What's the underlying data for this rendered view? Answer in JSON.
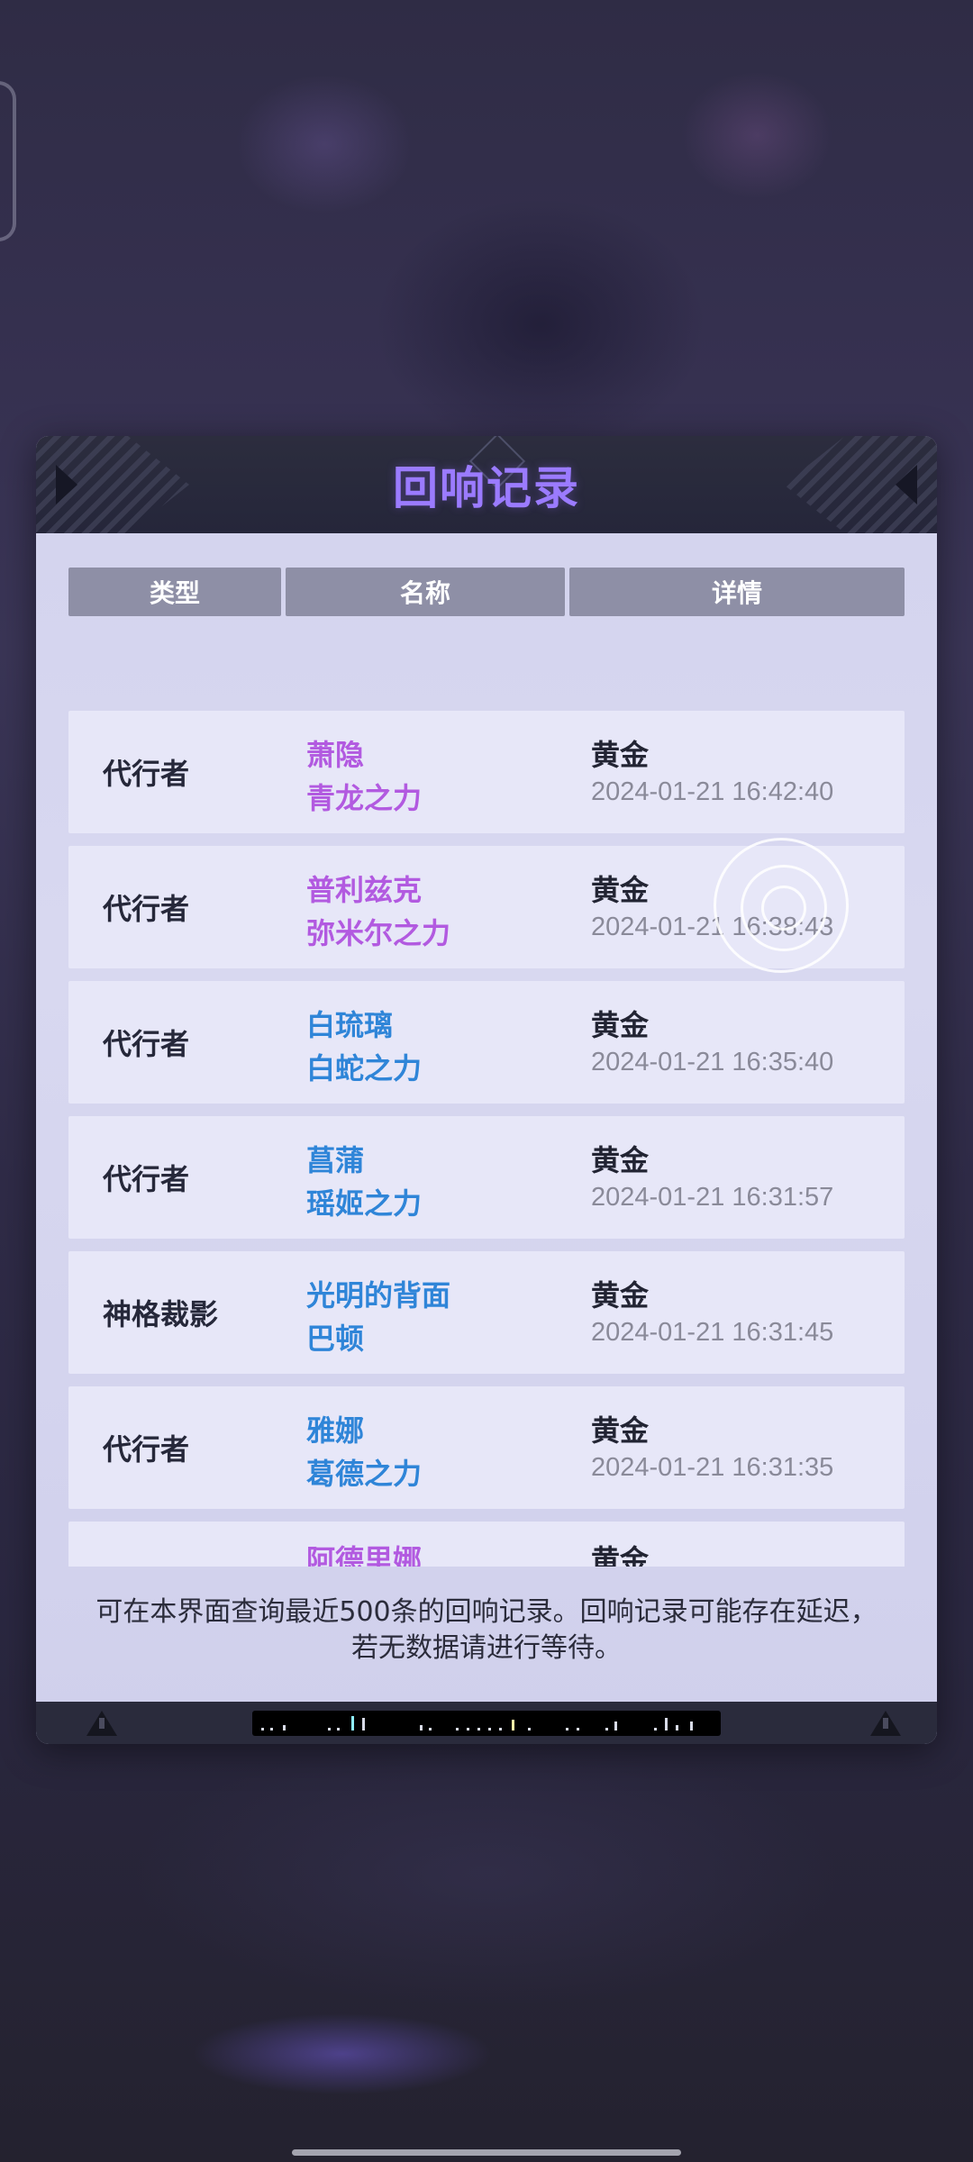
{
  "dialog": {
    "title": "回响记录",
    "columns": [
      "类型",
      "名称",
      "详情"
    ],
    "footer_note": "可在本界面查询最近500条的回响记录。回响记录可能存在延迟，若无数据请进行等待。"
  },
  "records": [
    {
      "type": "代行者",
      "name_line1": "萧隐",
      "name_line2": "青龙之力",
      "rarity": "黄金",
      "time": "2024-01-21 16:42:40",
      "name_color": "purple"
    },
    {
      "type": "代行者",
      "name_line1": "普利兹克",
      "name_line2": "弥米尔之力",
      "rarity": "黄金",
      "time": "2024-01-21 16:38:43",
      "name_color": "purple"
    },
    {
      "type": "代行者",
      "name_line1": "白琉璃",
      "name_line2": "白蛇之力",
      "rarity": "黄金",
      "time": "2024-01-21 16:35:40",
      "name_color": "blue"
    },
    {
      "type": "代行者",
      "name_line1": "菖蒲",
      "name_line2": "瑶姬之力",
      "rarity": "黄金",
      "time": "2024-01-21 16:31:57",
      "name_color": "blue"
    },
    {
      "type": "神格裁影",
      "name_line1": "光明的背面",
      "name_line2": "巴顿",
      "rarity": "黄金",
      "time": "2024-01-21 16:31:45",
      "name_color": "blue"
    },
    {
      "type": "代行者",
      "name_line1": "雅娜",
      "name_line2": "葛德之力",
      "rarity": "黄金",
      "time": "2024-01-21 16:31:35",
      "name_color": "blue"
    },
    {
      "type": "",
      "name_line1": "阿德里娜",
      "name_line2": "",
      "rarity": "黄金",
      "time": "",
      "name_color": "purple"
    }
  ],
  "colors": {
    "title": "#9b7bff",
    "name_purple": "#b25ae0",
    "name_blue": "#2f85d8",
    "header_bar": "#8e8fa6"
  },
  "icons": [
    "warning-icon",
    "warning-icon",
    "barcode-decoration",
    "touch-ring-icon"
  ]
}
